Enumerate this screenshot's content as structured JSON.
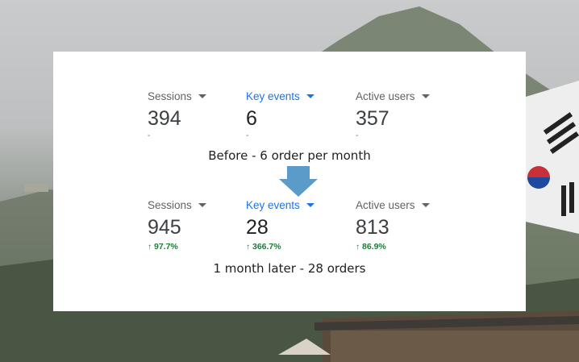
{
  "colors": {
    "label_gray": "#5f6368",
    "key_blue": "#1a73e8",
    "value_dark": "#3c4043",
    "increase_green": "#188038",
    "arrow_blue": "#5b9bc9",
    "card_bg": "#ffffff"
  },
  "before": {
    "metrics": [
      {
        "label": "Sessions",
        "value": "394",
        "sub": "-"
      },
      {
        "label": "Key events",
        "value": "6",
        "sub": "-"
      },
      {
        "label": "Active users",
        "value": "357",
        "sub": "-"
      }
    ],
    "caption": "Before - 6 order per month"
  },
  "after": {
    "metrics": [
      {
        "label": "Sessions",
        "value": "945",
        "change": "97.7%"
      },
      {
        "label": "Key events",
        "value": "28",
        "change": "366.7%"
      },
      {
        "label": "Active users",
        "value": "813",
        "change": "86.9%"
      }
    ],
    "caption": "1 month later - 28 orders"
  },
  "icons": {
    "dropdown": "caret-down-icon",
    "increase": "arrow-up-icon",
    "transition": "arrow-down-icon"
  }
}
